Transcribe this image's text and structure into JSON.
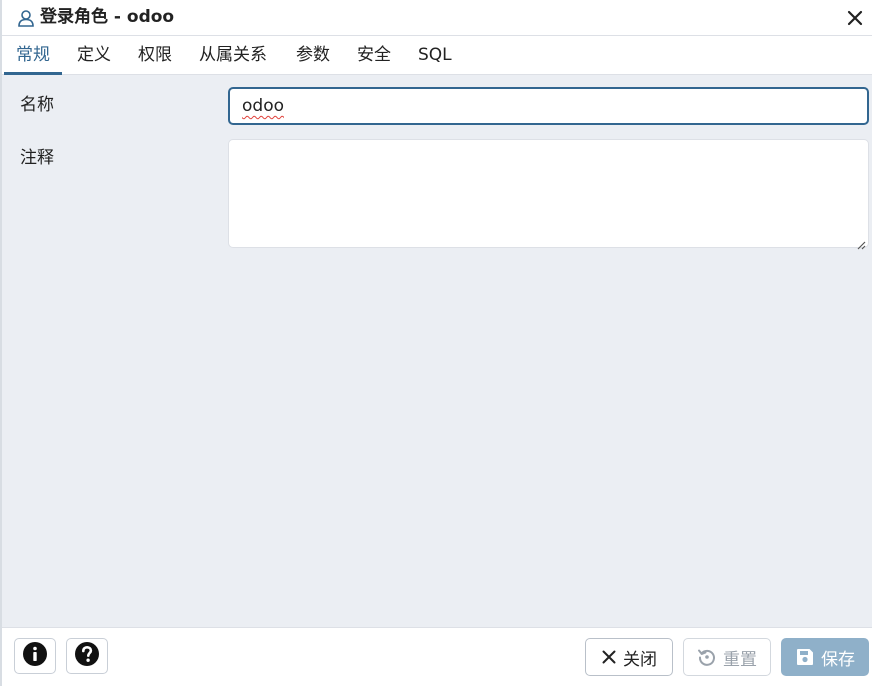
{
  "dialog": {
    "title": "登录角色 - odoo",
    "title_icon": "user-icon",
    "close_icon": "close-icon"
  },
  "tabs": [
    {
      "label": "常规",
      "active": true
    },
    {
      "label": "定义",
      "active": false
    },
    {
      "label": "权限",
      "active": false
    },
    {
      "label": "从属关系",
      "active": false
    },
    {
      "label": "参数",
      "active": false
    },
    {
      "label": "安全",
      "active": false
    },
    {
      "label": "SQL",
      "active": false
    }
  ],
  "form": {
    "name_label": "名称",
    "name_value": "odoo",
    "comment_label": "注释",
    "comment_value": ""
  },
  "footer": {
    "info_icon": "info-icon",
    "help_icon": "help-icon",
    "close_label": "关闭",
    "reset_label": "重置",
    "save_label": "保存"
  },
  "colors": {
    "accent": "#326690",
    "content_bg": "#ebeef3",
    "save_bg": "#8fb0c9",
    "spell_error": "#e0403a"
  }
}
